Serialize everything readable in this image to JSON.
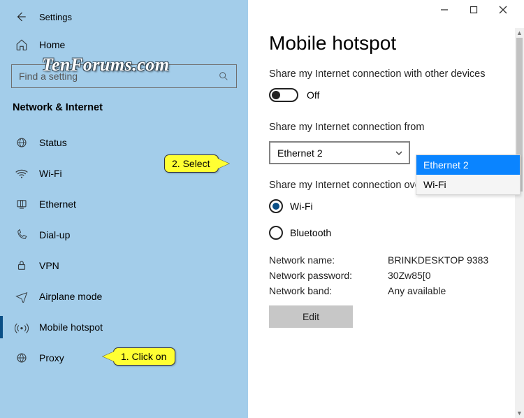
{
  "window": {
    "title": "Settings"
  },
  "watermark": "TenForums.com",
  "search": {
    "placeholder": "Find a setting"
  },
  "sidebar": {
    "home": "Home",
    "section": "Network & Internet",
    "items": [
      {
        "label": "Status"
      },
      {
        "label": "Wi-Fi"
      },
      {
        "label": "Ethernet"
      },
      {
        "label": "Dial-up"
      },
      {
        "label": "VPN"
      },
      {
        "label": "Airplane mode"
      },
      {
        "label": "Mobile hotspot"
      },
      {
        "label": "Proxy"
      }
    ]
  },
  "page": {
    "title": "Mobile hotspot",
    "share_label": "Share my Internet connection with other devices",
    "toggle_state": "Off",
    "from_label": "Share my Internet connection from",
    "from_value": "Ethernet 2",
    "over_label": "Share my Internet connection over",
    "radio_wifi": "Wi-Fi",
    "radio_bt": "Bluetooth",
    "net_name_k": "Network name:",
    "net_name_v": "BRINKDESKTOP 9383",
    "net_pass_k": "Network password:",
    "net_pass_v": "30Zw85[0",
    "net_band_k": "Network band:",
    "net_band_v": "Any available",
    "edit_btn": "Edit"
  },
  "dropdown": {
    "opt1": "Ethernet 2",
    "opt2": "Wi-Fi"
  },
  "callouts": {
    "c1": "1. Click on",
    "c2": "2. Select"
  }
}
